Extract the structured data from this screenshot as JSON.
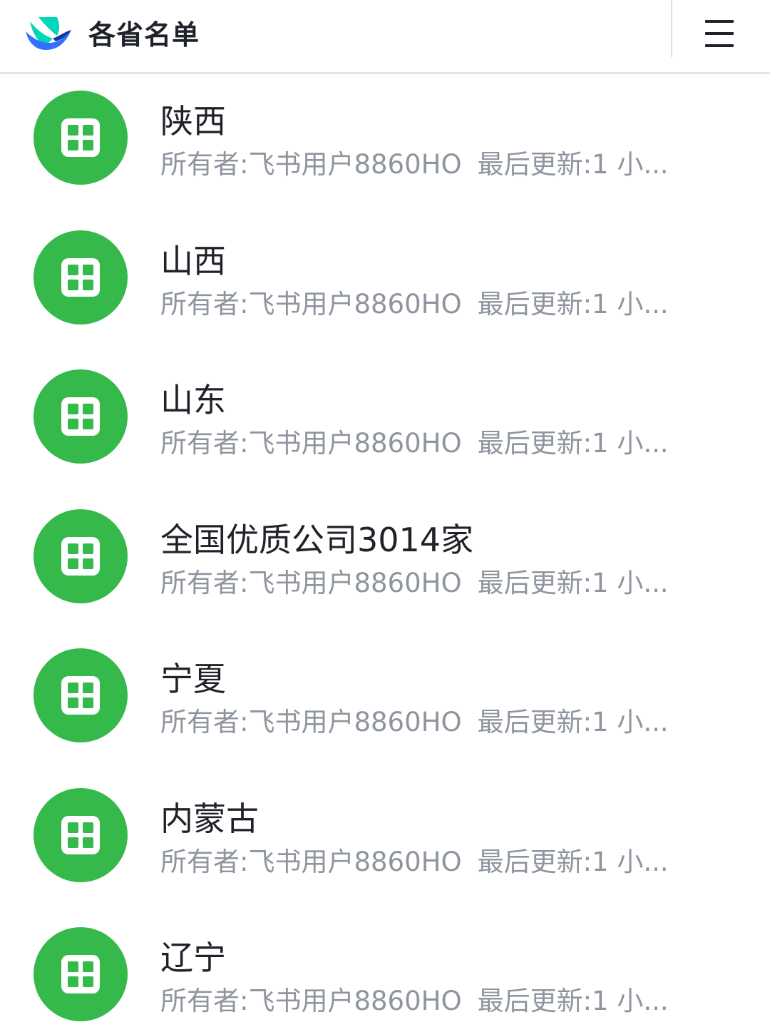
{
  "header": {
    "title": "各省名单",
    "logo_icon": "feishu-bird-logo",
    "menu_icon": "hamburger-menu-icon"
  },
  "colors": {
    "accent_green": "#34b94a",
    "title_text": "#1f2329",
    "meta_text": "#8f959e",
    "logo_blue": "#3370ff",
    "logo_teal": "#00d6b9"
  },
  "files": [
    {
      "name": "陕西",
      "owner_label": "所有者:",
      "owner": "飞书用户8860HO",
      "updated_label": "最后更新:",
      "updated": "1 小...",
      "icon": "sheet-icon"
    },
    {
      "name": "山西",
      "owner_label": "所有者:",
      "owner": "飞书用户8860HO",
      "updated_label": "最后更新:",
      "updated": "1 小...",
      "icon": "sheet-icon"
    },
    {
      "name": "山东",
      "owner_label": "所有者:",
      "owner": "飞书用户8860HO",
      "updated_label": "最后更新:",
      "updated": "1 小...",
      "icon": "sheet-icon"
    },
    {
      "name": "全国优质公司3014家",
      "owner_label": "所有者:",
      "owner": "飞书用户8860HO",
      "updated_label": "最后更新:",
      "updated": "1 小...",
      "icon": "sheet-icon"
    },
    {
      "name": "宁夏",
      "owner_label": "所有者:",
      "owner": "飞书用户8860HO",
      "updated_label": "最后更新:",
      "updated": "1 小...",
      "icon": "sheet-icon"
    },
    {
      "name": "内蒙古",
      "owner_label": "所有者:",
      "owner": "飞书用户8860HO",
      "updated_label": "最后更新:",
      "updated": "1 小...",
      "icon": "sheet-icon"
    },
    {
      "name": "辽宁",
      "owner_label": "所有者:",
      "owner": "飞书用户8860HO",
      "updated_label": "最后更新:",
      "updated": "1 小...",
      "icon": "sheet-icon"
    }
  ]
}
